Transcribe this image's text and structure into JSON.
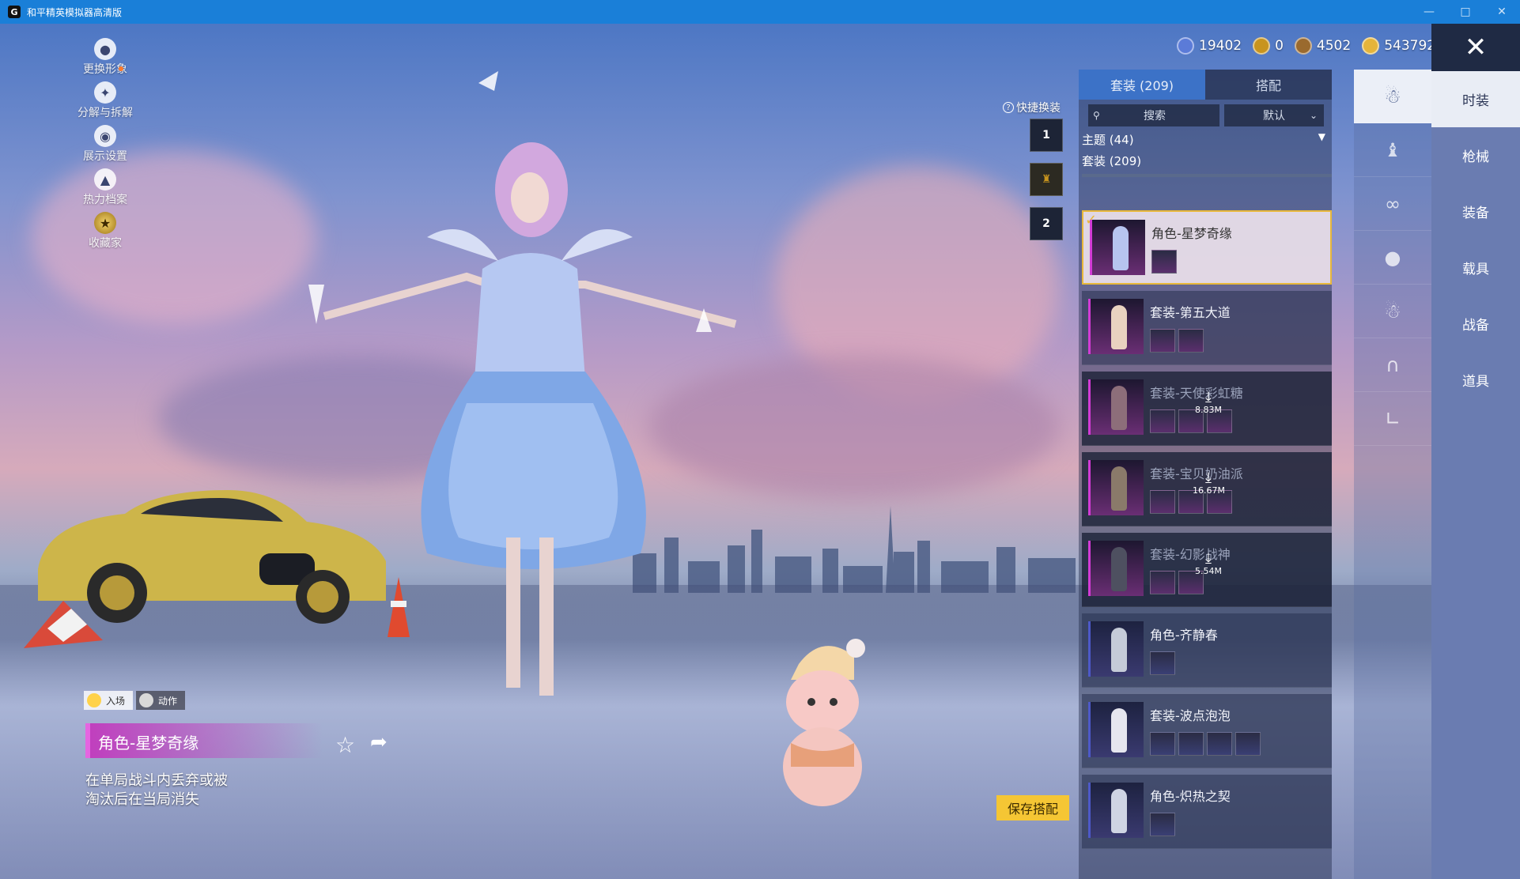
{
  "window": {
    "title": "和平精英模拟器高清版",
    "app_icon": "G"
  },
  "currencies": [
    {
      "icon": "globe-coin-icon",
      "value": "19402",
      "color": "#5b7bd8"
    },
    {
      "icon": "gold-token-icon",
      "value": "0",
      "color": "#c8941e"
    },
    {
      "icon": "bronze-coin-icon",
      "value": "4502",
      "color": "#9a6a2e"
    },
    {
      "icon": "gold-coin-icon",
      "value": "543792",
      "color": "#e5b43a"
    }
  ],
  "left_menu": [
    {
      "icon": "avatar-icon",
      "label": "更换形象"
    },
    {
      "icon": "puzzle-icon",
      "label": "分解与拆解"
    },
    {
      "icon": "eye-icon",
      "label": "展示设置"
    },
    {
      "icon": "flame-icon",
      "label": "热力档案"
    },
    {
      "icon": "medal-icon",
      "label": "收藏家"
    }
  ],
  "quick_change": {
    "label": "快捷换装",
    "slots": [
      "1",
      "",
      "2"
    ]
  },
  "outfit_panel": {
    "tabs": [
      {
        "label": "套装 (209)"
      },
      {
        "label": "搭配"
      }
    ],
    "search_placeholder": "搜索",
    "sort_value": "默认",
    "theme_label": "主题 (44)",
    "suit_label": "套装 (209)",
    "items": [
      {
        "name": "角色-星梦奇缘",
        "state": "selected",
        "sub_count": 1,
        "download": ""
      },
      {
        "name": "套装-第五大道",
        "state": "owned",
        "sub_count": 2,
        "download": ""
      },
      {
        "name": "套装-天使彩虹糖",
        "state": "locked",
        "sub_count": 3,
        "download": "8.83M"
      },
      {
        "name": "套装-宝贝奶油派",
        "state": "locked",
        "sub_count": 3,
        "download": "16.67M"
      },
      {
        "name": "套装-幻影战神",
        "state": "locked",
        "sub_count": 2,
        "download": "5.54M"
      },
      {
        "name": "角色-齐静春",
        "state": "owned",
        "sub_count": 1,
        "download": ""
      },
      {
        "name": "套装-波点泡泡",
        "state": "owned",
        "sub_count": 4,
        "download": ""
      },
      {
        "name": "角色-炽热之契",
        "state": "owned",
        "sub_count": 1,
        "download": ""
      }
    ]
  },
  "category_icons": [
    "character-icon",
    "hat-icon",
    "glasses-icon",
    "mask-icon",
    "outfit-icon",
    "pants-icon",
    "shoes-icon"
  ],
  "right_nav": [
    {
      "label": "时装",
      "active": true
    },
    {
      "label": "枪械"
    },
    {
      "label": "装备"
    },
    {
      "label": "载具"
    },
    {
      "label": "战备"
    },
    {
      "label": "道具"
    }
  ],
  "bottom_info": {
    "entrance_label": "入场",
    "action_label": "动作",
    "character_title": "角色-星梦奇缘",
    "description_line1": "在单局战斗内丢弃或被",
    "description_line2": "淘汰后在当局消失"
  },
  "save_button": "保存搭配",
  "colors": {
    "accent": "#3c72c7",
    "gold": "#e8b83b",
    "titlebar": "#1a7fd8",
    "highlight": "#c03fbe"
  }
}
